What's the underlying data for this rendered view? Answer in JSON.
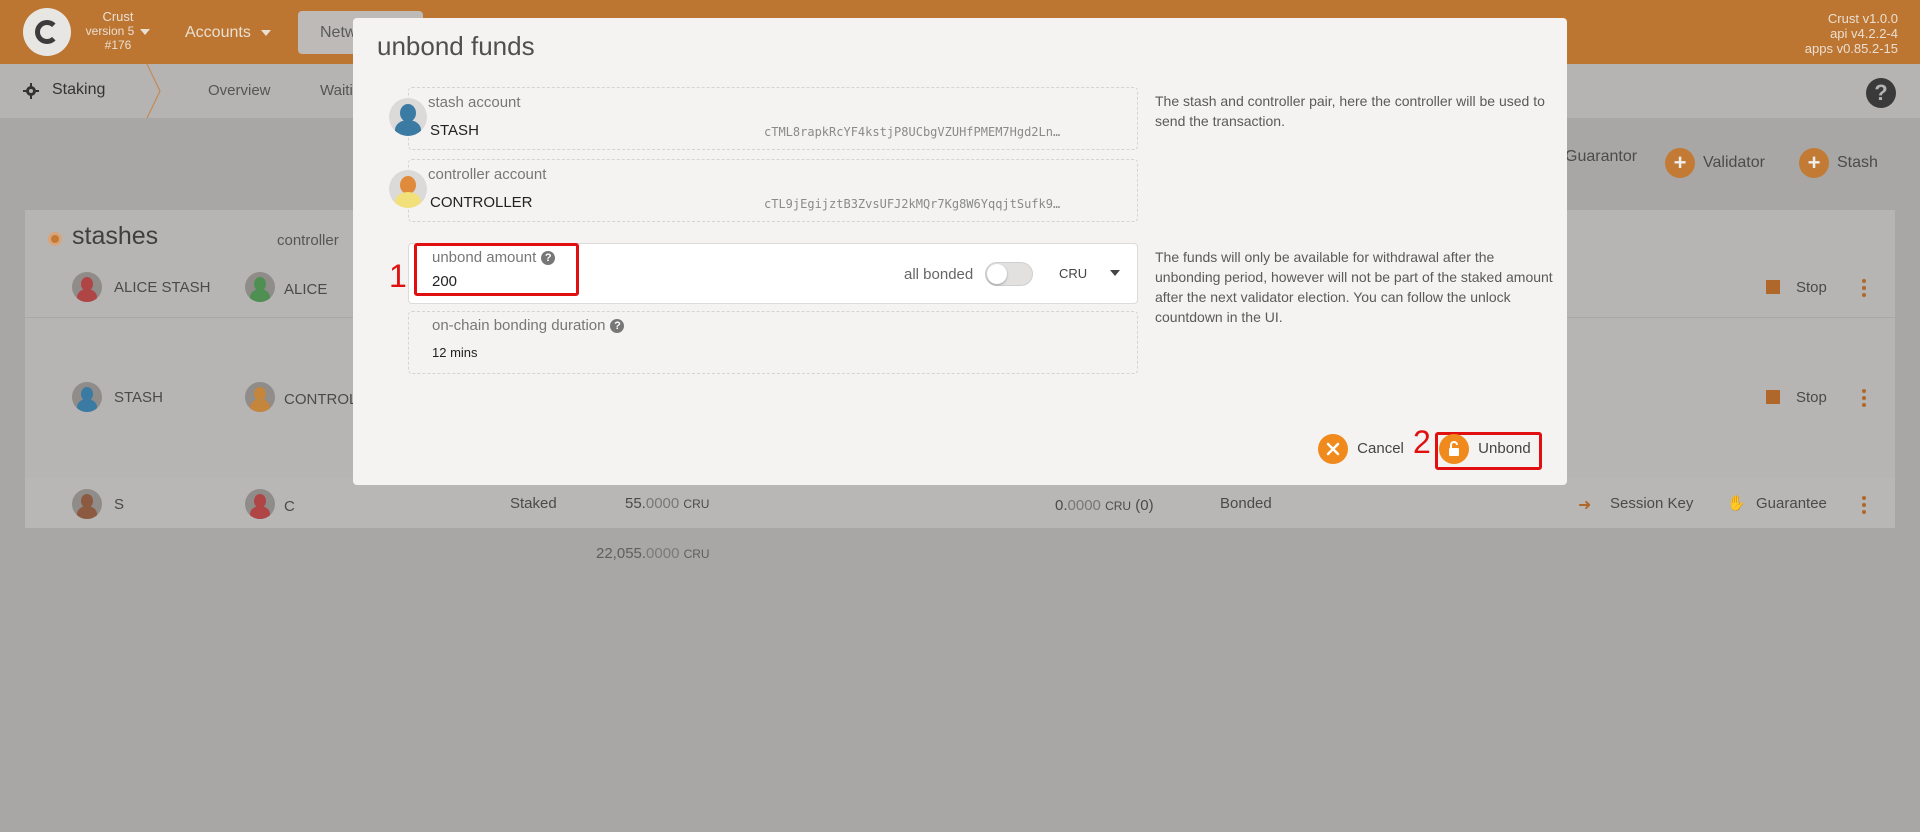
{
  "header": {
    "chain_name": "Crust",
    "chain_version": "version 5",
    "block": "#176",
    "nav_accounts": "Accounts",
    "nav_network": "Netw",
    "version_lines": [
      "Crust v1.0.0",
      "api v4.2.2-4",
      "apps v0.85.2-15"
    ]
  },
  "subnav": {
    "section": "Staking",
    "tabs": [
      "Overview",
      "Waiti"
    ]
  },
  "actions": {
    "guarantor": "Guarantor",
    "validator": "Validator",
    "stash": "Stash"
  },
  "stashes": {
    "title": "stashes",
    "col_controller": "controller",
    "rows": [
      {
        "stash": "ALICE STASH",
        "controller": "ALICE",
        "action": "Stop"
      },
      {
        "stash": "STASH",
        "controller": "CONTROL",
        "action": "Stop"
      },
      {
        "stash": "S",
        "controller": "C",
        "status": "Staked",
        "bonded_int": "55.",
        "bonded_dec": "0000",
        "unit": "CRU",
        "unbonding_int": "0.",
        "unbonding_dec": "0000",
        "unbonding_count": "(0)",
        "state": "Bonded",
        "session_key": "Session Key",
        "guarantee": "Guarantee"
      }
    ],
    "total_int": "22,055.",
    "total_dec": "0000",
    "total_unit": "CRU"
  },
  "modal": {
    "title": "unbond funds",
    "stash_label": "stash account",
    "stash_name": "STASH",
    "stash_address": "cTML8rapkRcYF4kstjP8UCbgVZUHfPMEM7Hgd2Ln…",
    "controller_label": "controller account",
    "controller_name": "CONTROLLER",
    "controller_address": "cTL9jEgijztB3ZvsUFJ2kMQr7Kg8W6YqqjtSufk9…",
    "help_accounts": "The stash and controller pair, here the controller will be used to send the transaction.",
    "amount_label": "unbond amount",
    "amount_value": "200",
    "all_bonded_label": "all bonded",
    "unit": "CRU",
    "help_amount": "The funds will only be available for withdrawal after the unbonding period, however will not be part of the staked amount after the next validator election. You can follow the unlock countdown in the UI.",
    "duration_label": "on-chain bonding duration",
    "duration_value": "12 mins",
    "cancel": "Cancel",
    "unbond": "Unbond",
    "annotation_1": "1",
    "annotation_2": "2"
  },
  "colors": {
    "accent": "#f08a1d",
    "annotation": "#e01010"
  }
}
